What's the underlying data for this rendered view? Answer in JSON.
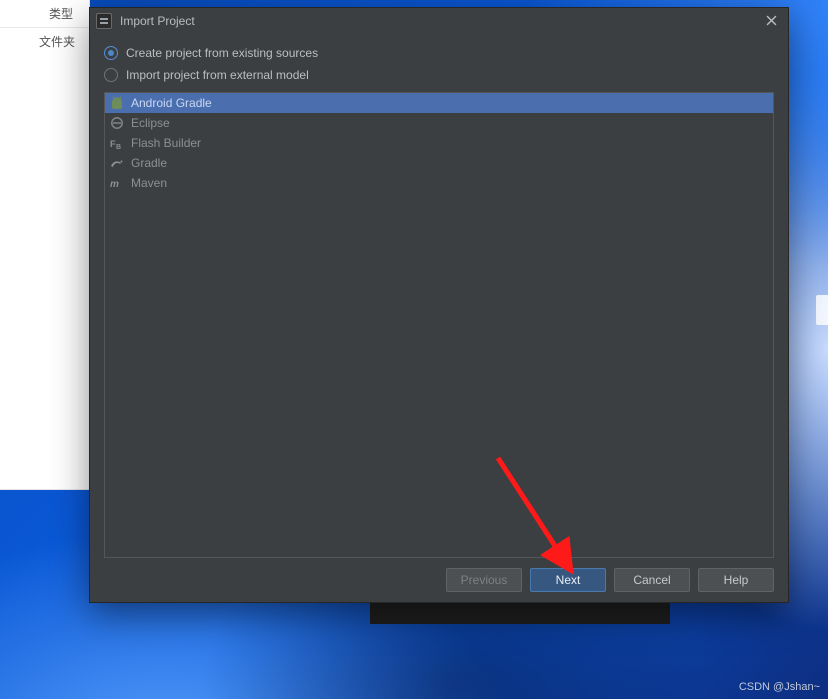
{
  "left_panel": {
    "header": "类型",
    "row1": "文件夹"
  },
  "dialog": {
    "title": "Import Project",
    "radios": {
      "existing": "Create project from existing sources",
      "external": "Import project from external model"
    },
    "models": [
      {
        "label": "Android Gradle",
        "icon": "android-icon",
        "selected": true
      },
      {
        "label": "Eclipse",
        "icon": "eclipse-icon",
        "selected": false
      },
      {
        "label": "Flash Builder",
        "icon": "flash-builder-icon",
        "selected": false
      },
      {
        "label": "Gradle",
        "icon": "gradle-icon",
        "selected": false
      },
      {
        "label": "Maven",
        "icon": "maven-icon",
        "selected": false
      }
    ],
    "buttons": {
      "previous": "Previous",
      "next": "Next",
      "cancel": "Cancel",
      "help": "Help"
    }
  },
  "watermark": "CSDN @Jshan~"
}
